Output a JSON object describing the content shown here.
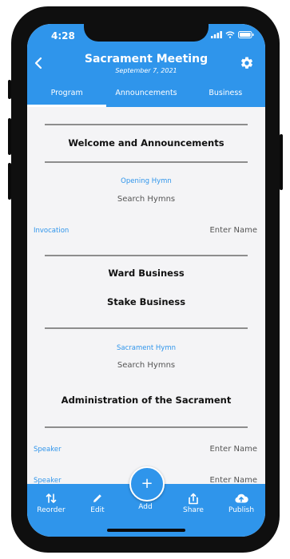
{
  "status": {
    "time": "4:28"
  },
  "header": {
    "title": "Sacrament Meeting",
    "date": "September 7, 2021",
    "colors": {
      "primary": "#2f95eb"
    },
    "icons": {
      "back": "chevron-left-icon",
      "settings": "gear-icon"
    }
  },
  "tabs": [
    {
      "label": "Program",
      "active": true
    },
    {
      "label": "Announcements",
      "active": false
    },
    {
      "label": "Business",
      "active": false
    }
  ],
  "program": {
    "welcome": "Welcome and Announcements",
    "opening_hymn_label": "Opening Hymn",
    "opening_hymn_placeholder": "Search Hymns",
    "invocation_label": "Invocation",
    "invocation_placeholder": "Enter Name",
    "ward_business": "Ward Business",
    "stake_business": "Stake Business",
    "sacrament_hymn_label": "Sacrament Hymn",
    "sacrament_hymn_placeholder": "Search Hymns",
    "administration": "Administration of the Sacrament",
    "speaker1_label": "Speaker",
    "speaker1_placeholder": "Enter Name",
    "speaker2_label": "Speaker",
    "speaker2_placeholder": "Enter Name"
  },
  "bottom_nav": {
    "reorder": "Reorder",
    "edit": "Edit",
    "add": "Add",
    "share": "Share",
    "publish": "Publish"
  }
}
